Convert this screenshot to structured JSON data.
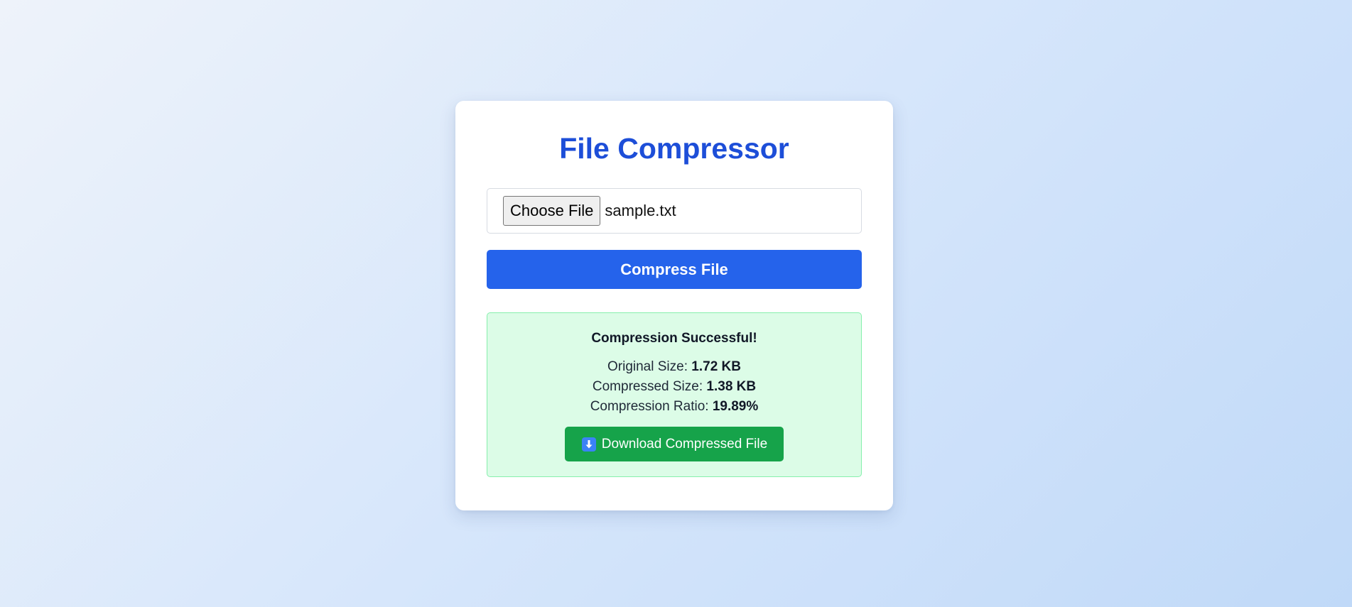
{
  "app": {
    "title": "File Compressor"
  },
  "file_input": {
    "button_label": "Choose File",
    "file_name": "sample.txt"
  },
  "compress_button": {
    "label": "Compress File"
  },
  "result": {
    "heading": "Compression Successful!",
    "original_size_label": "Original Size: ",
    "original_size_value": "1.72 KB",
    "compressed_size_label": "Compressed Size: ",
    "compressed_size_value": "1.38 KB",
    "ratio_label": "Compression Ratio: ",
    "ratio_value": "19.89%",
    "download_label": "Download Compressed File",
    "download_icon": "down-arrow-icon"
  },
  "colors": {
    "accent": "#2563eb",
    "title": "#1d4ed8",
    "success_bg": "#dcfce7",
    "success_border": "#86efac",
    "download": "#16a34a"
  }
}
